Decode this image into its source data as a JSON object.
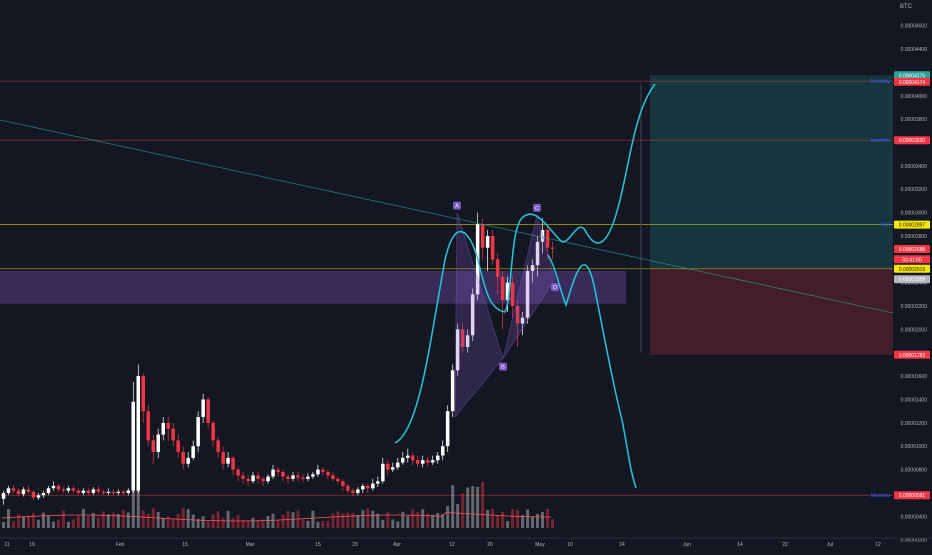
{
  "chart_data": {
    "type": "candlestick",
    "quote_currency": "BTC",
    "y_axis": {
      "unit": "BTC",
      "ylim": [
        3e-07,
        4.7e-06
      ],
      "ticks": [
        "0.00004600",
        "0.00004400",
        "0.00004000",
        "0.00003800",
        "0.00003400",
        "0.00003200",
        "0.00003000",
        "0.00002800",
        "0.00002400",
        "0.00002200",
        "0.00002000",
        "0.00001600",
        "0.00001400",
        "0.00001200",
        "0.00001000",
        "0.00000800",
        "0.00000400",
        "0.00000200"
      ],
      "tick_values": [
        4.6e-06,
        4.4e-06,
        4e-06,
        3.8e-06,
        3.4e-06,
        3.2e-06,
        3e-06,
        2.8e-06,
        2.4e-06,
        2.2e-06,
        2e-06,
        1.6e-06,
        1.4e-06,
        1.2e-06,
        1e-06,
        8e-07,
        4e-07,
        2e-07
      ]
    },
    "x_axis": {
      "ticks": [
        "11",
        "19",
        "Feb",
        "15",
        "Mar",
        "15",
        "23",
        "Apr",
        "12",
        "20",
        "May",
        "10",
        "24",
        "Jun",
        "14",
        "22",
        "Jul",
        "12"
      ]
    },
    "price_labels": [
      {
        "text": "0.00004175",
        "value": 4.175e-06,
        "color": "#26a69a"
      },
      {
        "text": "0.00004174",
        "value": 4.12e-06,
        "color": "#f23645"
      },
      {
        "text": "0.00003620",
        "value": 3.62e-06,
        "color": "#f23645"
      },
      {
        "text": "0.00002897",
        "value": 2.897e-06,
        "color": "#f7e600"
      },
      {
        "text": "0.00002688",
        "value": 2.688e-06,
        "color": "#f23645"
      },
      {
        "text": "03:41:50",
        "value": 2.6e-06,
        "color": "#f23645"
      },
      {
        "text": "0.00002519",
        "value": 2.519e-06,
        "color": "#f7e600"
      },
      {
        "text": "0.00002508",
        "value": 2.43e-06,
        "color": "#b2b5be"
      },
      {
        "text": "0.00001783",
        "value": 1.783e-06,
        "color": "#f23645"
      },
      {
        "text": "0.00000581",
        "value": 5.81e-07,
        "color": "#f23645"
      }
    ],
    "level_labels": [
      {
        "text": "Monthly",
        "value": 4.125e-06
      },
      {
        "text": "Monthly",
        "value": 3.62e-06
      },
      {
        "text": "R10",
        "value": 2.897e-06
      },
      {
        "text": "Monthly",
        "value": 5.81e-07
      }
    ],
    "pattern_points": [
      "A",
      "B",
      "C",
      "D"
    ],
    "pattern_values": [
      {
        "label": "A",
        "value": 3e-06
      },
      {
        "label": "B",
        "value": 1.75e-06
      },
      {
        "label": "C",
        "value": 2.98e-06
      },
      {
        "label": "D",
        "value": 2.43e-06
      }
    ],
    "candles": [
      [
        5.5e-07,
        6e-07,
        5e-07,
        6.2e-07
      ],
      [
        6e-07,
        6.4e-07,
        5.8e-07,
        6.6e-07
      ],
      [
        6.4e-07,
        6.2e-07,
        6e-07,
        6.7e-07
      ],
      [
        6.2e-07,
        5.9e-07,
        5.7e-07,
        6.4e-07
      ],
      [
        5.9e-07,
        6.3e-07,
        5.7e-07,
        6.5e-07
      ],
      [
        6.3e-07,
        6.1e-07,
        5.9e-07,
        6.6e-07
      ],
      [
        6.1e-07,
        5.6e-07,
        5.4e-07,
        6.2e-07
      ],
      [
        5.6e-07,
        5.8e-07,
        5.4e-07,
        6e-07
      ],
      [
        5.8e-07,
        6e-07,
        5.6e-07,
        6.2e-07
      ],
      [
        6e-07,
        6.4e-07,
        5.8e-07,
        6.6e-07
      ],
      [
        6.4e-07,
        6.6e-07,
        6.2e-07,
        7e-07
      ],
      [
        6.6e-07,
        6.3e-07,
        6.1e-07,
        6.8e-07
      ],
      [
        6.3e-07,
        6.2e-07,
        6e-07,
        6.5e-07
      ],
      [
        6.2e-07,
        6.4e-07,
        6e-07,
        6.6e-07
      ],
      [
        6.4e-07,
        6.2e-07,
        6e-07,
        6.6e-07
      ],
      [
        6.2e-07,
        6e-07,
        5.8e-07,
        6.4e-07
      ],
      [
        6e-07,
        6.2e-07,
        5.8e-07,
        6.4e-07
      ],
      [
        6.2e-07,
        6e-07,
        5.8e-07,
        6.4e-07
      ],
      [
        6e-07,
        6.3e-07,
        5.8e-07,
        6.5e-07
      ],
      [
        6.3e-07,
        6.1e-07,
        5.9e-07,
        6.6e-07
      ],
      [
        6.1e-07,
        6e-07,
        5.8e-07,
        6.3e-07
      ],
      [
        6e-07,
        6.1e-07,
        5.8e-07,
        6.4e-07
      ],
      [
        6.1e-07,
        6e-07,
        5.8e-07,
        6.3e-07
      ],
      [
        6e-07,
        6.1e-07,
        5.8e-07,
        6.3e-07
      ],
      [
        6.1e-07,
        6e-07,
        5.8e-07,
        6.3e-07
      ],
      [
        6e-07,
        6.2e-07,
        5.8e-07,
        6.4e-07
      ],
      [
        6.2e-07,
        1.38e-06,
        6e-07,
        1.55e-06
      ],
      [
        6.2e-07,
        1.6e-06,
        6e-07,
        1.7e-06
      ],
      [
        1.6e-06,
        1.3e-06,
        1.2e-06,
        1.62e-06
      ],
      [
        1.3e-06,
        1.05e-06,
        1e-06,
        1.35e-06
      ],
      [
        1.05e-06,
        9.5e-07,
        8.5e-07,
        1.1e-06
      ],
      [
        9.5e-07,
        1.1e-06,
        9e-07,
        1.15e-06
      ],
      [
        1.1e-06,
        1.2e-06,
        1.05e-06,
        1.25e-06
      ],
      [
        1.2e-06,
        1.15e-06,
        1.05e-06,
        1.25e-06
      ],
      [
        1.15e-06,
        1.05e-06,
        1e-06,
        1.2e-06
      ],
      [
        1.05e-06,
        9.5e-07,
        9e-07,
        1.1e-06
      ],
      [
        9.5e-07,
        8.5e-07,
        8e-07,
        1e-06
      ],
      [
        8.5e-07,
        9e-07,
        8.2e-07,
        9.5e-07
      ],
      [
        9e-07,
        1e-06,
        8.8e-07,
        1.05e-06
      ],
      [
        1e-06,
        1.25e-06,
        9.5e-07,
        1.3e-06
      ],
      [
        1.25e-06,
        1.4e-06,
        1.2e-06,
        1.45e-06
      ],
      [
        1.4e-06,
        1.2e-06,
        1.15e-06,
        1.42e-06
      ],
      [
        1.2e-06,
        1.05e-06,
        1e-06,
        1.22e-06
      ],
      [
        1.05e-06,
        9.5e-07,
        9e-07,
        1.08e-06
      ],
      [
        9.5e-07,
        8.5e-07,
        8e-07,
        1e-06
      ],
      [
        8.5e-07,
        9e-07,
        8.2e-07,
        9.5e-07
      ],
      [
        9e-07,
        8e-07,
        7.5e-07,
        9.2e-07
      ],
      [
        8e-07,
        7.5e-07,
        7e-07,
        8.2e-07
      ],
      [
        7.5e-07,
        7.2e-07,
        6.8e-07,
        7.8e-07
      ],
      [
        7.2e-07,
        7e-07,
        6.6e-07,
        7.5e-07
      ],
      [
        7e-07,
        7.5e-07,
        6.8e-07,
        7.8e-07
      ],
      [
        7.5e-07,
        7.2e-07,
        6.8e-07,
        7.8e-07
      ],
      [
        7.2e-07,
        7e-07,
        6.6e-07,
        7.4e-07
      ],
      [
        7e-07,
        7.4e-07,
        6.8e-07,
        7.6e-07
      ],
      [
        7.4e-07,
        8e-07,
        7.2e-07,
        8.4e-07
      ],
      [
        8e-07,
        7.8e-07,
        7.4e-07,
        8.2e-07
      ],
      [
        7.8e-07,
        7.4e-07,
        7e-07,
        8e-07
      ],
      [
        7.4e-07,
        7.2e-07,
        6.8e-07,
        7.6e-07
      ],
      [
        7.2e-07,
        7.5e-07,
        7e-07,
        7.8e-07
      ],
      [
        7.5e-07,
        7.3e-07,
        7e-07,
        7.8e-07
      ],
      [
        7.3e-07,
        7.2e-07,
        6.9e-07,
        7.6e-07
      ],
      [
        7.2e-07,
        7.4e-07,
        7e-07,
        7.7e-07
      ],
      [
        7.4e-07,
        7.6e-07,
        7.2e-07,
        7.8e-07
      ],
      [
        7.6e-07,
        8e-07,
        7.4e-07,
        8.4e-07
      ],
      [
        8e-07,
        7.8e-07,
        7.5e-07,
        8.2e-07
      ],
      [
        7.8e-07,
        7.5e-07,
        7.2e-07,
        8e-07
      ],
      [
        7.5e-07,
        7.2e-07,
        7e-07,
        7.8e-07
      ],
      [
        7.2e-07,
        7e-07,
        6.8e-07,
        7.4e-07
      ],
      [
        7e-07,
        6.6e-07,
        6.2e-07,
        7.2e-07
      ],
      [
        6.6e-07,
        6.2e-07,
        6e-07,
        6.8e-07
      ],
      [
        6.2e-07,
        6e-07,
        5.7e-07,
        6.4e-07
      ],
      [
        6e-07,
        6.3e-07,
        5.8e-07,
        6.5e-07
      ],
      [
        6.3e-07,
        6.6e-07,
        6e-07,
        6.8e-07
      ],
      [
        6.6e-07,
        6.4e-07,
        6e-07,
        6.8e-07
      ],
      [
        6.4e-07,
        6.8e-07,
        6.2e-07,
        7.2e-07
      ],
      [
        6.8e-07,
        7e-07,
        6.5e-07,
        7.4e-07
      ],
      [
        7e-07,
        8.5e-07,
        6.8e-07,
        9e-07
      ],
      [
        8.5e-07,
        8e-07,
        7.5e-07,
        8.8e-07
      ],
      [
        8e-07,
        8.2e-07,
        7.8e-07,
        8.6e-07
      ],
      [
        8.2e-07,
        8.6e-07,
        8e-07,
        9e-07
      ],
      [
        8.6e-07,
        9e-07,
        8.4e-07,
        9.5e-07
      ],
      [
        9e-07,
        9.2e-07,
        8.6e-07,
        9.8e-07
      ],
      [
        9.2e-07,
        8.8e-07,
        8.4e-07,
        9.5e-07
      ],
      [
        8.8e-07,
        8.5e-07,
        8.2e-07,
        9.2e-07
      ],
      [
        8.5e-07,
        8.8e-07,
        8.2e-07,
        9.2e-07
      ],
      [
        8.8e-07,
        8.6e-07,
        8.3e-07,
        9.1e-07
      ],
      [
        8.6e-07,
        8.8e-07,
        8.4e-07,
        9.2e-07
      ],
      [
        8.8e-07,
        9.2e-07,
        8.5e-07,
        9.5e-07
      ],
      [
        9.2e-07,
        1e-06,
        8.8e-07,
        1.05e-06
      ],
      [
        1e-06,
        1.3e-06,
        9.5e-07,
        1.35e-06
      ],
      [
        1.3e-06,
        1.65e-06,
        1.25e-06,
        1.7e-06
      ],
      [
        1.65e-06,
        2e-06,
        1.6e-06,
        2.05e-06
      ],
      [
        2e-06,
        1.85e-06,
        1.8e-06,
        2.05e-06
      ],
      [
        1.85e-06,
        1.95e-06,
        1.8e-06,
        2e-06
      ],
      [
        1.95e-06,
        2.3e-06,
        1.9e-06,
        2.35e-06
      ],
      [
        2.3e-06,
        2.9e-06,
        2.25e-06,
        3e-06
      ],
      [
        2.9e-06,
        2.7e-06,
        2.6e-06,
        2.95e-06
      ],
      [
        2.7e-06,
        2.8e-06,
        2.5e-06,
        2.85e-06
      ],
      [
        2.8e-06,
        2.6e-06,
        2.55e-06,
        2.85e-06
      ],
      [
        2.6e-06,
        2.45e-06,
        2.3e-06,
        2.65e-06
      ],
      [
        2.45e-06,
        2.25e-06,
        2e-06,
        2.5e-06
      ],
      [
        2.25e-06,
        2.4e-06,
        2.15e-06,
        2.45e-06
      ],
      [
        2.4e-06,
        2.2e-06,
        2.1e-06,
        2.45e-06
      ],
      [
        2.2e-06,
        2.05e-06,
        1.85e-06,
        2.25e-06
      ],
      [
        2.05e-06,
        2.1e-06,
        1.95e-06,
        2.15e-06
      ],
      [
        2.1e-06,
        2.5e-06,
        2.05e-06,
        2.55e-06
      ],
      [
        2.5e-06,
        2.55e-06,
        2.4e-06,
        2.6e-06
      ],
      [
        2.55e-06,
        2.75e-06,
        2.45e-06,
        2.8e-06
      ],
      [
        2.75e-06,
        2.85e-06,
        2.65e-06,
        2.95e-06
      ],
      [
        2.85e-06,
        2.7e-06,
        2.6e-06,
        2.9e-06
      ],
      [
        2.7e-06,
        2.69e-06,
        2.6e-06,
        2.75e-06
      ]
    ],
    "volume_peaks": [
      0.2,
      1.0,
      0.6,
      0.3,
      0.5
    ]
  }
}
